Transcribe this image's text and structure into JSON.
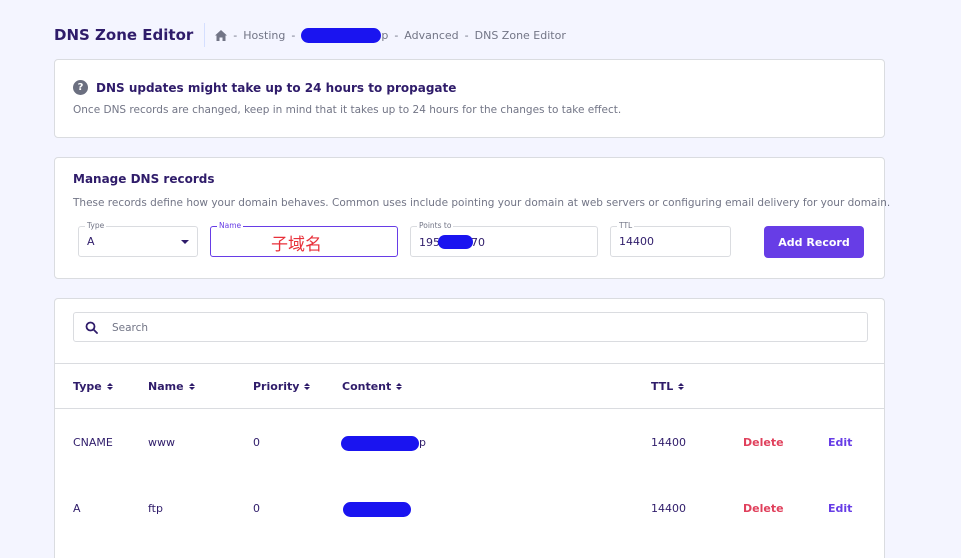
{
  "header": {
    "title": "DNS Zone Editor",
    "breadcrumbs": {
      "hosting": "Hosting",
      "domain_suffix": "p",
      "advanced": "Advanced",
      "current": "DNS Zone Editor",
      "separator": "-"
    }
  },
  "notice": {
    "title": "DNS updates might take up to 24 hours to propagate",
    "text": "Once DNS records are changed, keep in mind that it takes up to 24 hours for the changes to take effect.",
    "icon": "question-circle-icon"
  },
  "manage": {
    "title": "Manage DNS records",
    "description": "These records define how your domain behaves. Common uses include pointing your domain at web servers or configuring email delivery for your domain.",
    "form": {
      "type_label": "Type",
      "type_value": "A",
      "name_label": "Name",
      "name_value": "",
      "name_annotation": "子域名",
      "points_label": "Points to",
      "points_prefix": "195",
      "points_suffix": "70",
      "ttl_label": "TTL",
      "ttl_value": "14400",
      "add_button": "Add Record"
    }
  },
  "records": {
    "search_placeholder": "Search",
    "columns": [
      "Type",
      "Name",
      "Priority",
      "Content",
      "TTL"
    ],
    "rows": [
      {
        "type": "CNAME",
        "name": "www",
        "priority": "0",
        "content_suffix": "p",
        "ttl": "14400",
        "delete": "Delete",
        "edit": "Edit"
      },
      {
        "type": "A",
        "name": "ftp",
        "priority": "0",
        "content_suffix": "",
        "ttl": "14400",
        "delete": "Delete",
        "edit": "Edit"
      }
    ]
  },
  "colors": {
    "accent": "#673de6",
    "delete": "#e0405c",
    "annotation": "#e8303a",
    "redaction": "#1a14f0",
    "text": "#2f1c6a",
    "muted": "#727586"
  }
}
